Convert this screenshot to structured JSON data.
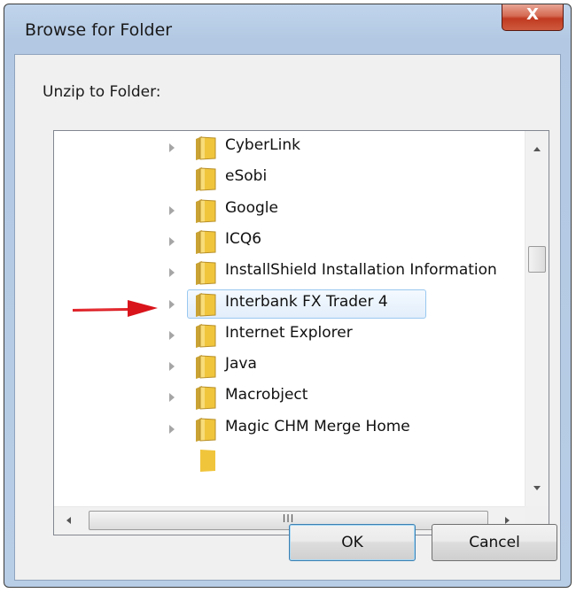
{
  "window": {
    "title": "Browse for Folder",
    "close_glyph": "X"
  },
  "dialog": {
    "instruction": "Unzip to Folder:"
  },
  "tree": {
    "items": [
      {
        "label": "CyberLink",
        "expandable": true,
        "selected": false
      },
      {
        "label": "eSobi",
        "expandable": false,
        "selected": false
      },
      {
        "label": "Google",
        "expandable": true,
        "selected": false
      },
      {
        "label": "ICQ6",
        "expandable": true,
        "selected": false
      },
      {
        "label": "InstallShield Installation Information",
        "expandable": true,
        "selected": false
      },
      {
        "label": "Interbank FX Trader 4",
        "expandable": true,
        "selected": true
      },
      {
        "label": "Internet Explorer",
        "expandable": true,
        "selected": false
      },
      {
        "label": "Java",
        "expandable": true,
        "selected": false
      },
      {
        "label": "Macrobject",
        "expandable": true,
        "selected": false
      },
      {
        "label": "Magic CHM Merge Home",
        "expandable": true,
        "selected": false
      }
    ],
    "hscroll_grip": "III"
  },
  "buttons": {
    "ok": "OK",
    "cancel": "Cancel"
  },
  "colors": {
    "folder": "#f0c53c",
    "selection": "#99c8f0",
    "annotation_arrow": "#d9141b",
    "close_button": "#c83c22"
  },
  "icons": {
    "folder": "folder-icon",
    "expander": "expand-arrow-icon",
    "close": "close-icon",
    "annotation": "red-arrow-icon"
  }
}
